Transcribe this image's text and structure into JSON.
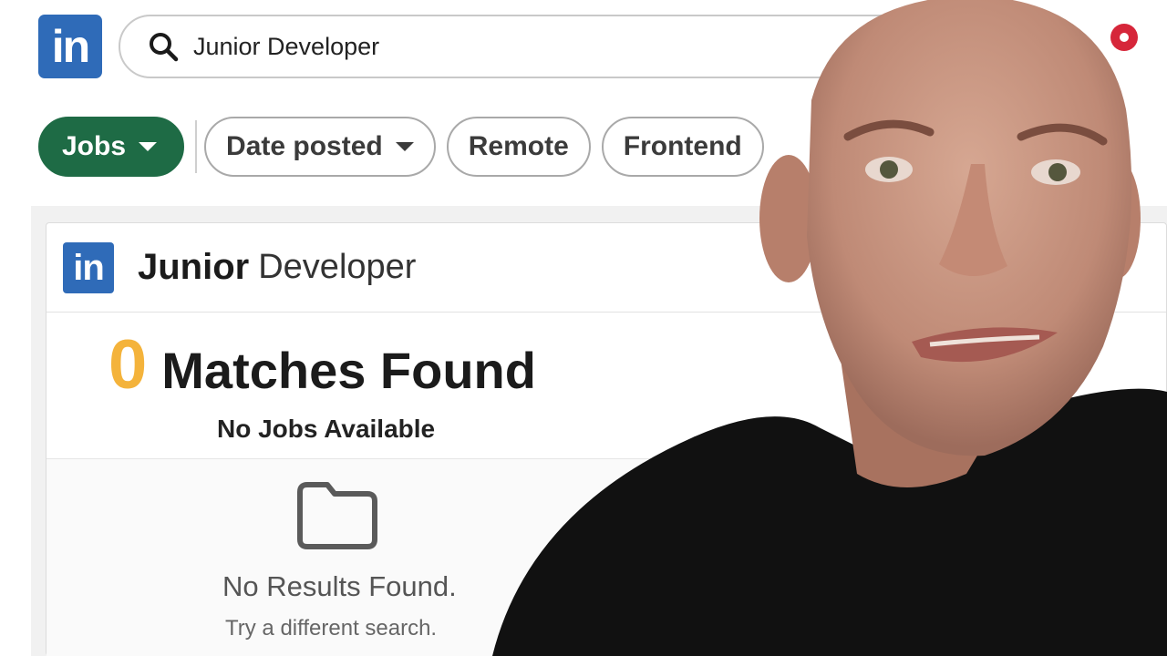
{
  "header": {
    "logo_text": "in",
    "search_value": "Junior Developer",
    "icons": [
      "search-icon",
      "notification-icon"
    ]
  },
  "filters": {
    "jobs_label": "Jobs",
    "date_posted_label": "Date posted",
    "remote_label": "Remote",
    "frontend_label": "Frontend"
  },
  "results": {
    "logo_text": "in",
    "title_bold": "Junior",
    "title_light": "Developer",
    "match_count": "0",
    "match_label": "Matches Found",
    "subtitle": "No Jobs Available",
    "empty_title": "No Results Found.",
    "empty_hint": "Try a different search.",
    "empty_icon": "folder-icon"
  },
  "colors": {
    "brand_blue": "#2f6bb8",
    "jobs_green": "#1e6b45",
    "count_orange": "#f4b33b",
    "notification_red": "#d6263a"
  }
}
